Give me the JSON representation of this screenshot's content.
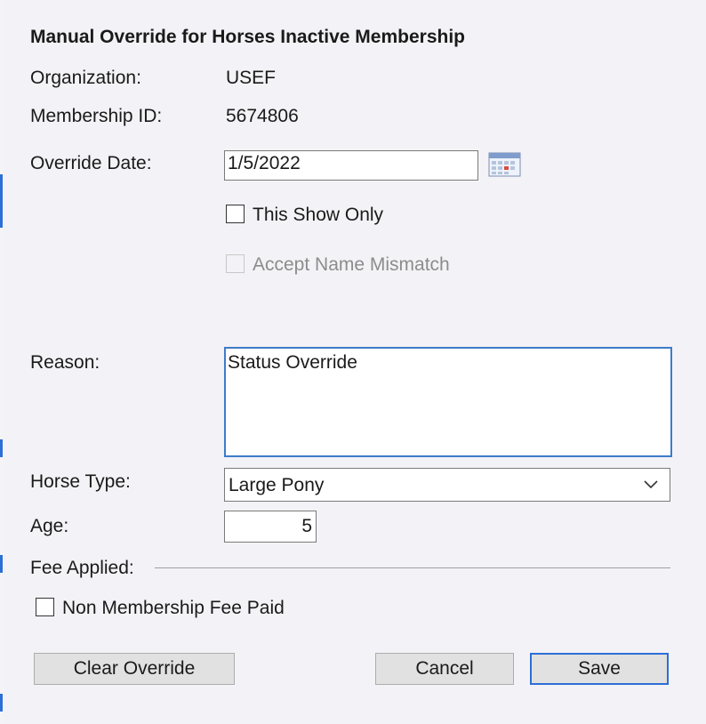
{
  "dialog": {
    "title": "Manual Override for Horses Inactive Membership",
    "organization": {
      "label": "Organization:",
      "value": "USEF"
    },
    "membership_id": {
      "label": "Membership ID:",
      "value": "5674806"
    },
    "override_date": {
      "label": "Override Date:",
      "value": "1/5/2022",
      "icon": "calendar-icon"
    },
    "this_show_only": {
      "label": "This Show Only",
      "checked": false,
      "enabled": true
    },
    "accept_name_mismatch": {
      "label": "Accept Name Mismatch",
      "checked": false,
      "enabled": false
    },
    "reason": {
      "label": "Reason:",
      "value": "Status Override"
    },
    "horse_type": {
      "label": "Horse Type:",
      "value": "Large Pony",
      "icon": "chevron-down-icon"
    },
    "age": {
      "label": "Age:",
      "value": "5"
    },
    "fee_applied": {
      "label": "Fee Applied:"
    },
    "non_membership_fee_paid": {
      "label": "Non Membership Fee Paid",
      "checked": false
    },
    "buttons": {
      "clear_override": "Clear Override",
      "cancel": "Cancel",
      "save": "Save"
    }
  },
  "colors": {
    "accent": "#2c6fd6",
    "background": "#f3f2f6",
    "focus_border": "#3d7cc9"
  }
}
